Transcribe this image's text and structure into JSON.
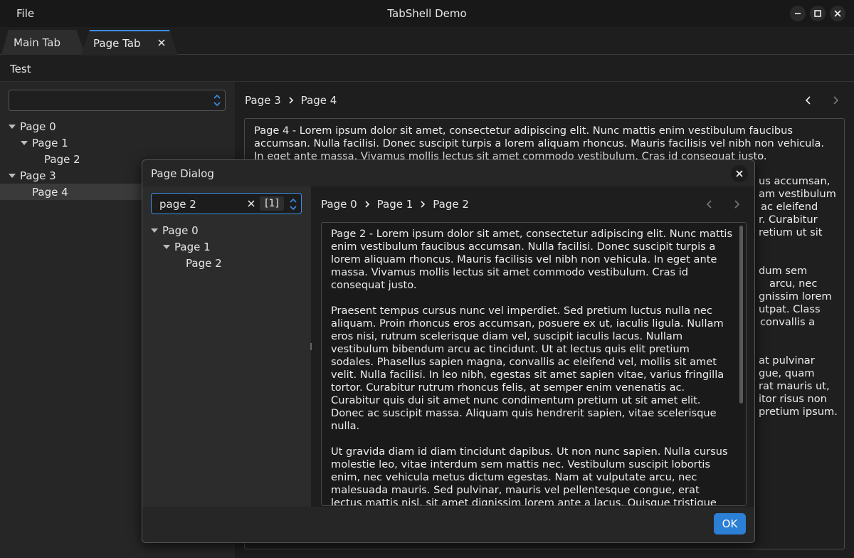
{
  "window": {
    "title": "TabShell Demo",
    "menu": {
      "file": "File"
    }
  },
  "tabs": [
    {
      "label": "Main Tab",
      "active": false
    },
    {
      "label": "Page Tab",
      "active": true,
      "closable": true
    }
  ],
  "page": {
    "toolbar_label": "Test",
    "combo_value": "",
    "tree": [
      {
        "label": "Page 0",
        "expanded": true
      },
      {
        "label": "Page 1",
        "expanded": true
      },
      {
        "label": "Page 2"
      },
      {
        "label": "Page 3",
        "expanded": true
      },
      {
        "label": "Page 4",
        "selected": true
      }
    ],
    "breadcrumb": [
      "Page 3",
      "Page 4"
    ],
    "content_intro": "Page 4 - Lorem ipsum dolor sit amet, consectetur adipiscing elit. Nunc mattis enim vestibulum faucibus accumsan. Nulla facilisi. Donec suscipit turpis a lorem aliquam rhoncus. Mauris facilisis vel nibh non vehicula. In eget ante massa. Vivamus mollis lectus sit amet commodo vestibulum. Cras id consequat justo.",
    "visible_fragments": [
      "us accumsan,",
      "am vestibulum",
      "ac eleifend",
      "r. Curabitur",
      "retium ut sit",
      "dum sem",
      "arcu, nec",
      "gnissim lorem",
      "utpat. Class",
      "convallis a",
      "at pulvinar",
      "gue, quam",
      "rat mauris ut,",
      "itor risus non",
      "pretium ipsum."
    ]
  },
  "dialog": {
    "title": "Page Dialog",
    "search": {
      "value": "page 2",
      "count": "[1]"
    },
    "tree": [
      {
        "label": "Page 0",
        "expanded": true
      },
      {
        "label": "Page 1",
        "expanded": true
      },
      {
        "label": "Page 2"
      }
    ],
    "breadcrumb": [
      "Page 0",
      "Page 1",
      "Page 2"
    ],
    "paragraphs": [
      "Page 2 - Lorem ipsum dolor sit amet, consectetur adipiscing elit. Nunc mattis enim vestibulum faucibus accumsan. Nulla facilisi. Donec suscipit turpis a lorem aliquam rhoncus. Mauris facilisis vel nibh non vehicula. In eget ante massa. Vivamus mollis lectus sit amet commodo vestibulum. Cras id consequat justo.",
      "Praesent tempus cursus nunc vel imperdiet. Sed pretium luctus nulla nec aliquam. Proin rhoncus eros accumsan, posuere ex ut, iaculis ligula. Nullam eros nisi, rutrum scelerisque diam vel, suscipit iaculis lacus. Nullam vestibulum bibendum arcu ac tincidunt. Ut at lectus quis elit pretium sodales. Phasellus sapien magna, convallis ac eleifend vel, mollis sit amet velit. Nulla facilisi. In leo nibh, egestas sit amet sapien vitae, varius fringilla tortor. Curabitur rutrum rhoncus felis, at semper enim venenatis ac. Curabitur quis dui sit amet nunc condimentum pretium ut sit amet elit. Donec ac suscipit massa. Aliquam quis hendrerit sapien, vitae scelerisque nulla.",
      "Ut gravida diam id diam tincidunt dapibus. Ut non nunc sapien. Nulla cursus molestie leo, vitae interdum sem mattis nec. Vestibulum suscipit lobortis enim, nec vehicula metus dictum egestas. Nam at vulputate arcu, nec malesuada mauris. Sed pulvinar, mauris vel pellentesque congue, erat lectus mattis nisl, sit amet dignissim lorem ante a lacus. Quisque tristique efficitur justo, ut lacinia felis tristique at. Praesent finibus molestie volutpat. Class aptent taciti"
    ],
    "ok_label": "OK"
  },
  "colors": {
    "accent": "#3d8ee6",
    "ok_button": "#2b7fd4"
  }
}
